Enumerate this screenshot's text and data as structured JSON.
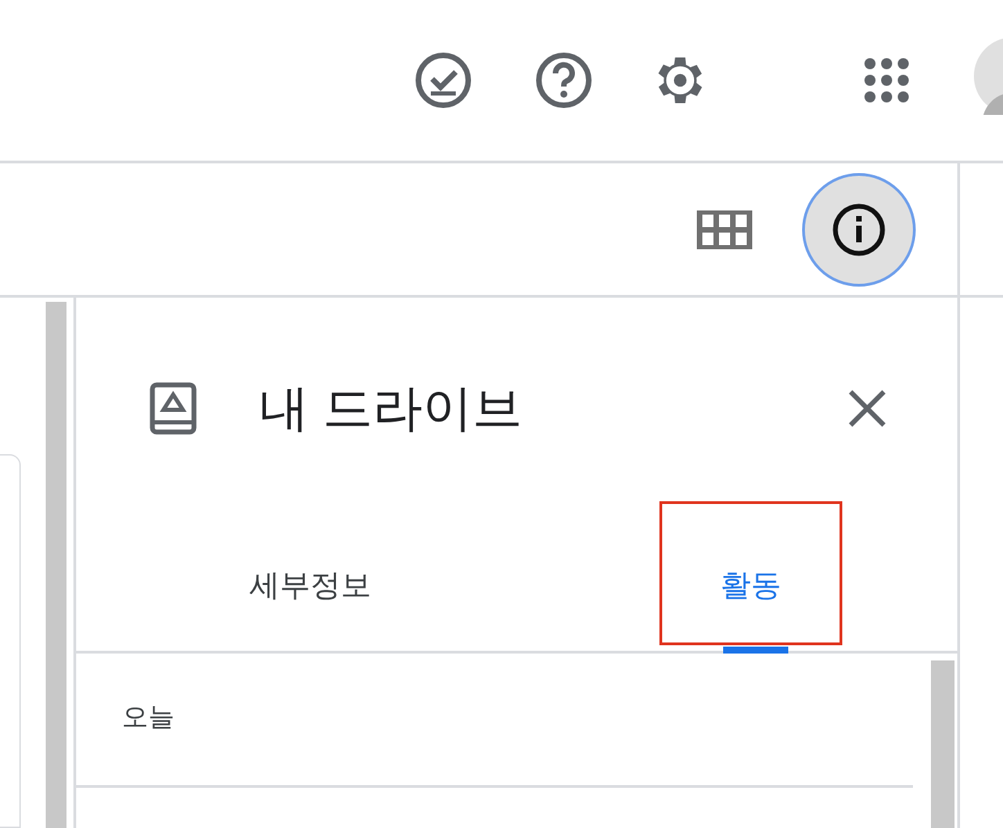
{
  "panel": {
    "title": "내 드라이브"
  },
  "tabs": [
    {
      "label": "세부정보",
      "selected": false,
      "highlighted": false
    },
    {
      "label": "활동",
      "selected": true,
      "highlighted": true
    }
  ],
  "activity": {
    "section": "오늘"
  }
}
